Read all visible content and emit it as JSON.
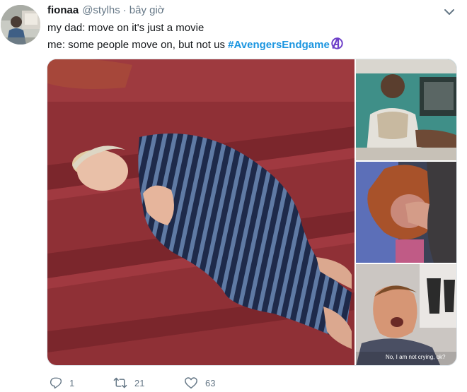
{
  "tweet": {
    "display_name": "fionaa",
    "handle": "@stylhs",
    "separator": "·",
    "timestamp": "bây giờ",
    "text_line1": "my dad: move on it's just a movie",
    "text_line2_prefix": "me: some people move on, but not us ",
    "hashtag": "#AvengersEndgame",
    "media_caption": "No, I am not crying, ok?"
  },
  "icons": {
    "more": "chevron-down-icon",
    "hashflag": "avengers-logo-icon",
    "reply": "reply-icon",
    "retweet": "retweet-icon",
    "like": "heart-icon"
  },
  "actions": {
    "reply_count": "1",
    "retweet_count": "21",
    "like_count": "63"
  },
  "colors": {
    "text": "#14171a",
    "muted": "#657786",
    "hashtag": "#1b95e0",
    "hashflag": "#6e40c9"
  }
}
